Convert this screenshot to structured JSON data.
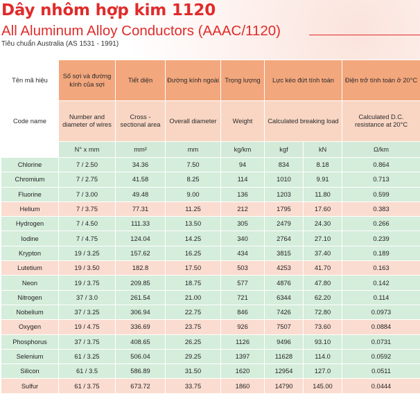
{
  "title_vi": "Dây nhôm hợp kim 1120",
  "title_en": "All Aluminum Alloy Conductors (AAAC/1120)",
  "standard": "Tiêu chuẩn Australia (AS 1531 - 1991)",
  "colors": {
    "title": "#e02b2b",
    "header": "#f3a77d",
    "header_light": "#f9d6c4",
    "row_green": "#d5eddb",
    "row_pink": "#fbdcd0"
  },
  "headers_vi": [
    "Tên mã hiệu",
    "Số sợi và đường kính của sợi",
    "Tiết diện",
    "Đường kính ngoài",
    "Trọng lượng",
    "Lực kéo đứt tính toán",
    "Điện trở tính toán ở 20°C"
  ],
  "headers_en": [
    "Code name",
    "Number and diameter of wires",
    "Cross - sectional area",
    "Overall diameter",
    "Weight",
    "Calculated breaking load",
    "Calculated D.C. resistance at 20°C"
  ],
  "units": [
    "",
    "N° x mm",
    "mm²",
    "mm",
    "kg/km",
    "kgf",
    "kN",
    "Ω/km"
  ],
  "rows": [
    [
      "Chlorine",
      "7 / 2.50",
      "34.36",
      "7.50",
      "94",
      "834",
      "8.18",
      "0.864"
    ],
    [
      "Chromium",
      "7 / 2.75",
      "41.58",
      "8.25",
      "114",
      "1010",
      "9.91",
      "0.713"
    ],
    [
      "Fluorine",
      "7 / 3.00",
      "49.48",
      "9.00",
      "136",
      "1203",
      "11.80",
      "0.599"
    ],
    [
      "Helium",
      "7 / 3.75",
      "77.31",
      "11.25",
      "212",
      "1795",
      "17.60",
      "0.383"
    ],
    [
      "Hydrogen",
      "7 / 4.50",
      "111.33",
      "13.50",
      "305",
      "2479",
      "24.30",
      "0.266"
    ],
    [
      "Iodine",
      "7 / 4.75",
      "124.04",
      "14.25",
      "340",
      "2764",
      "27.10",
      "0.239"
    ],
    [
      "Krypton",
      "19 / 3.25",
      "157.62",
      "16.25",
      "434",
      "3815",
      "37.40",
      "0.189"
    ],
    [
      "Lutetium",
      "19 / 3.50",
      "182.8",
      "17.50",
      "503",
      "4253",
      "41.70",
      "0.163"
    ],
    [
      "Neon",
      "19 / 3.75",
      "209.85",
      "18.75",
      "577",
      "4876",
      "47.80",
      "0.142"
    ],
    [
      "Nitrogen",
      "37 / 3.0",
      "261.54",
      "21.00",
      "721",
      "6344",
      "62.20",
      "0.114"
    ],
    [
      "Nobelium",
      "37 / 3.25",
      "306.94",
      "22.75",
      "846",
      "7426",
      "72.80",
      "0.0973"
    ],
    [
      "Oxygen",
      "19 / 4.75",
      "336.69",
      "23.75",
      "926",
      "7507",
      "73.60",
      "0.0884"
    ],
    [
      "Phosphorus",
      "37 / 3.75",
      "408.65",
      "26.25",
      "1126",
      "9496",
      "93.10",
      "0.0731"
    ],
    [
      "Selenium",
      "61 / 3.25",
      "506.04",
      "29.25",
      "1397",
      "11628",
      "114.0",
      "0.0592"
    ],
    [
      "Silicon",
      "61 / 3.5",
      "586.89",
      "31.50",
      "1620",
      "12954",
      "127.0",
      "0.0511"
    ],
    [
      "Sulfur",
      "61 / 3.75",
      "673.72",
      "33.75",
      "1860",
      "14790",
      "145.00",
      "0.0444"
    ]
  ],
  "row_styles": [
    "g",
    "g",
    "g",
    "p",
    "g",
    "g",
    "g",
    "p",
    "g",
    "g",
    "g",
    "p",
    "g",
    "g",
    "g",
    "p"
  ]
}
